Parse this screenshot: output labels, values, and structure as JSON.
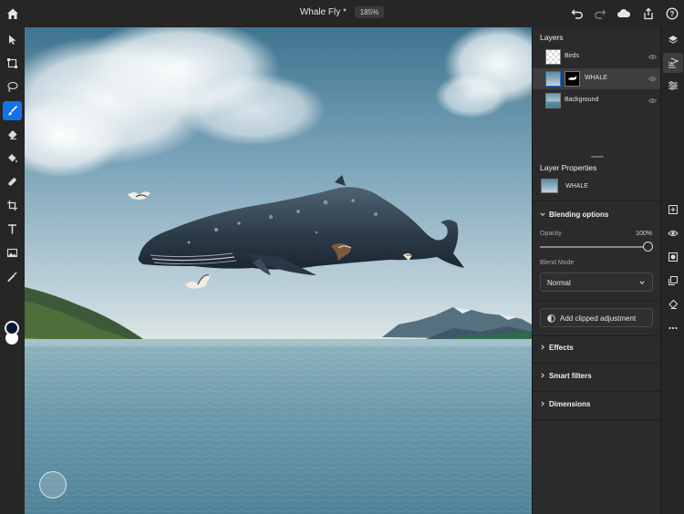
{
  "app": {
    "doc_title": "Whale Fly *",
    "zoom": "185%"
  },
  "toolbar": {
    "tools": [
      "select-tool",
      "transform-tool",
      "lasso-tool",
      "brush-tool",
      "eraser-tool",
      "fill-tool",
      "healing-tool",
      "crop-tool",
      "type-tool",
      "place-image-tool",
      "eyedropper-tool"
    ],
    "active_tool": "brush-tool",
    "foreground_color": "#0b1630",
    "background_color": "#ffffff"
  },
  "layers_panel": {
    "title": "Layers",
    "layers": [
      {
        "name": "Birds",
        "selected": false
      },
      {
        "name": "WHALE",
        "selected": true
      },
      {
        "name": "Background",
        "selected": false
      }
    ]
  },
  "layer_properties": {
    "title": "Layer Properties",
    "layer_name": "WHALE",
    "blending": {
      "title": "Blending options",
      "opacity_label": "Opacity",
      "opacity_value": "100%",
      "opacity_fraction": 1.0,
      "blend_mode_label": "Blend Mode",
      "blend_mode_value": "Normal"
    },
    "clip_button": "Add clipped adjustment",
    "sections": [
      "Effects",
      "Smart filters",
      "Dimensions"
    ]
  },
  "colors": {
    "accent": "#1473e6",
    "panel_bg": "#2b2b2b"
  }
}
